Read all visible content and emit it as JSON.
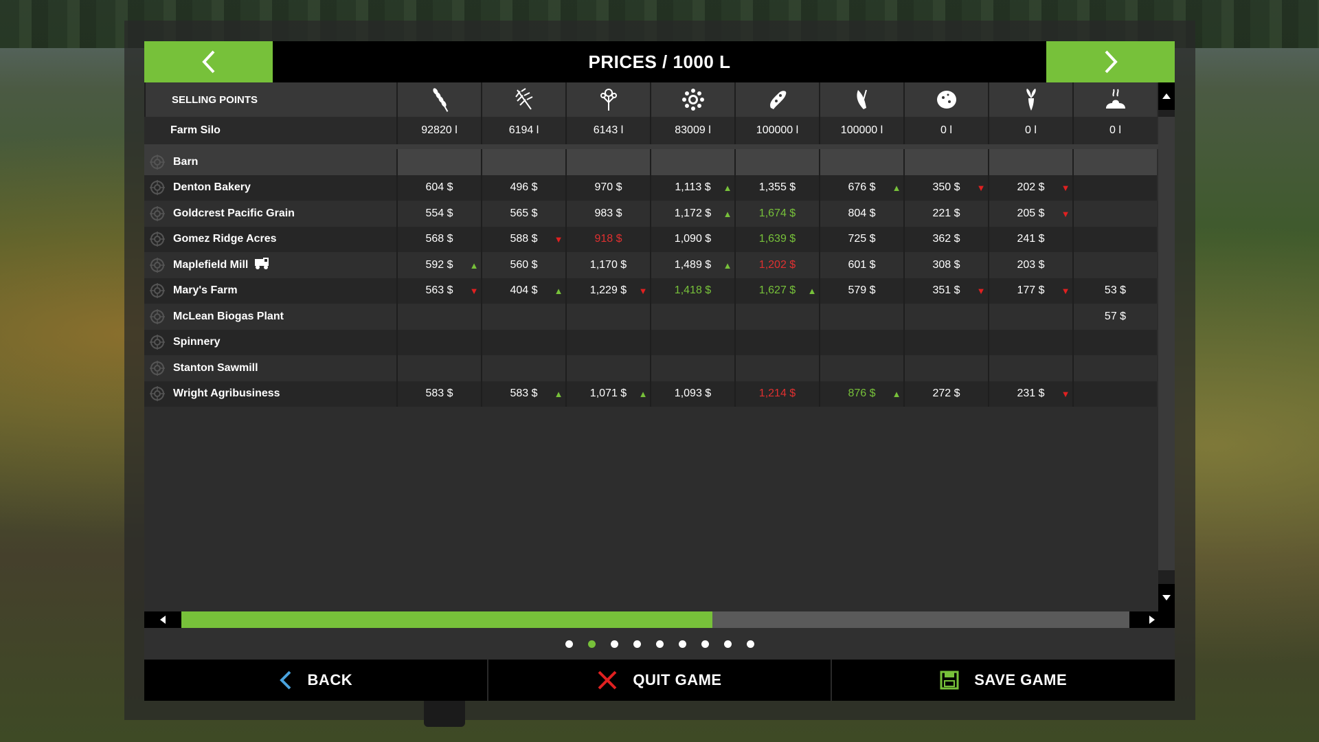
{
  "header": {
    "title": "PRICES / 1000 L",
    "prev_icon": "chevron-left-icon",
    "next_icon": "chevron-right-icon"
  },
  "columns": {
    "label": "SELLING POINTS",
    "icons": [
      "wheat-icon",
      "barley-icon",
      "canola-icon",
      "sunflower-icon",
      "soybean-icon",
      "maize-icon",
      "potato-icon",
      "sugarbeet-icon",
      "manure-icon"
    ]
  },
  "silo": {
    "name": "Farm Silo",
    "values": [
      "92820 l",
      "6194 l",
      "6143 l",
      "83009 l",
      "100000 l",
      "100000 l",
      "0 l",
      "0 l",
      "0 l"
    ]
  },
  "rows": [
    {
      "name": "Barn",
      "cells": [
        null,
        null,
        null,
        null,
        null,
        null,
        null,
        null,
        null
      ],
      "style": "barn"
    },
    {
      "name": "Denton Bakery",
      "cells": [
        {
          "v": "604 $"
        },
        {
          "v": "496 $"
        },
        {
          "v": "970 $"
        },
        {
          "v": "1,113 $",
          "t": "up"
        },
        {
          "v": "1,355 $"
        },
        {
          "v": "676 $",
          "t": "up"
        },
        {
          "v": "350 $",
          "t": "down"
        },
        {
          "v": "202 $",
          "t": "down"
        },
        null
      ]
    },
    {
      "name": "Goldcrest Pacific Grain",
      "cells": [
        {
          "v": "554 $"
        },
        {
          "v": "565 $"
        },
        {
          "v": "983 $"
        },
        {
          "v": "1,172 $",
          "t": "up"
        },
        {
          "v": "1,674 $",
          "c": "green"
        },
        {
          "v": "804 $"
        },
        {
          "v": "221 $"
        },
        {
          "v": "205 $",
          "t": "down"
        },
        null
      ]
    },
    {
      "name": "Gomez Ridge Acres",
      "cells": [
        {
          "v": "568 $"
        },
        {
          "v": "588 $",
          "t": "down"
        },
        {
          "v": "918 $",
          "c": "red"
        },
        {
          "v": "1,090 $"
        },
        {
          "v": "1,639 $",
          "c": "green"
        },
        {
          "v": "725 $"
        },
        {
          "v": "362 $"
        },
        {
          "v": "241 $"
        },
        null
      ]
    },
    {
      "name": "Maplefield Mill",
      "train": true,
      "cells": [
        {
          "v": "592 $",
          "t": "up"
        },
        {
          "v": "560 $"
        },
        {
          "v": "1,170 $"
        },
        {
          "v": "1,489 $",
          "t": "up"
        },
        {
          "v": "1,202 $",
          "c": "red"
        },
        {
          "v": "601 $"
        },
        {
          "v": "308 $"
        },
        {
          "v": "203 $"
        },
        null
      ]
    },
    {
      "name": "Mary's Farm",
      "cells": [
        {
          "v": "563 $",
          "t": "down"
        },
        {
          "v": "404 $",
          "t": "up"
        },
        {
          "v": "1,229 $",
          "t": "down"
        },
        {
          "v": "1,418 $",
          "c": "green"
        },
        {
          "v": "1,627 $",
          "c": "green",
          "t": "up"
        },
        {
          "v": "579 $"
        },
        {
          "v": "351 $",
          "t": "down"
        },
        {
          "v": "177 $",
          "t": "down"
        },
        {
          "v": "53 $"
        }
      ]
    },
    {
      "name": "McLean Biogas Plant",
      "cells": [
        null,
        null,
        null,
        null,
        null,
        null,
        null,
        null,
        {
          "v": "57 $"
        }
      ]
    },
    {
      "name": "Spinnery",
      "cells": [
        null,
        null,
        null,
        null,
        null,
        null,
        null,
        null,
        null
      ]
    },
    {
      "name": "Stanton Sawmill",
      "cells": [
        null,
        null,
        null,
        null,
        null,
        null,
        null,
        null,
        null
      ]
    },
    {
      "name": "Wright Agribusiness",
      "cells": [
        {
          "v": "583 $"
        },
        {
          "v": "583 $",
          "t": "up"
        },
        {
          "v": "1,071 $",
          "t": "up"
        },
        {
          "v": "1,093 $"
        },
        {
          "v": "1,214 $",
          "c": "red"
        },
        {
          "v": "876 $",
          "c": "green",
          "t": "up"
        },
        {
          "v": "272 $"
        },
        {
          "v": "231 $",
          "t": "down"
        },
        null
      ]
    }
  ],
  "scroll": {
    "horizontal_fraction": 0.56
  },
  "pages": {
    "count": 9,
    "active": 1
  },
  "footer": {
    "back": "BACK",
    "quit": "QUIT GAME",
    "save": "SAVE GAME"
  },
  "colors": {
    "accent": "#77c13a",
    "up": "#77c13a",
    "down": "#e02020"
  }
}
